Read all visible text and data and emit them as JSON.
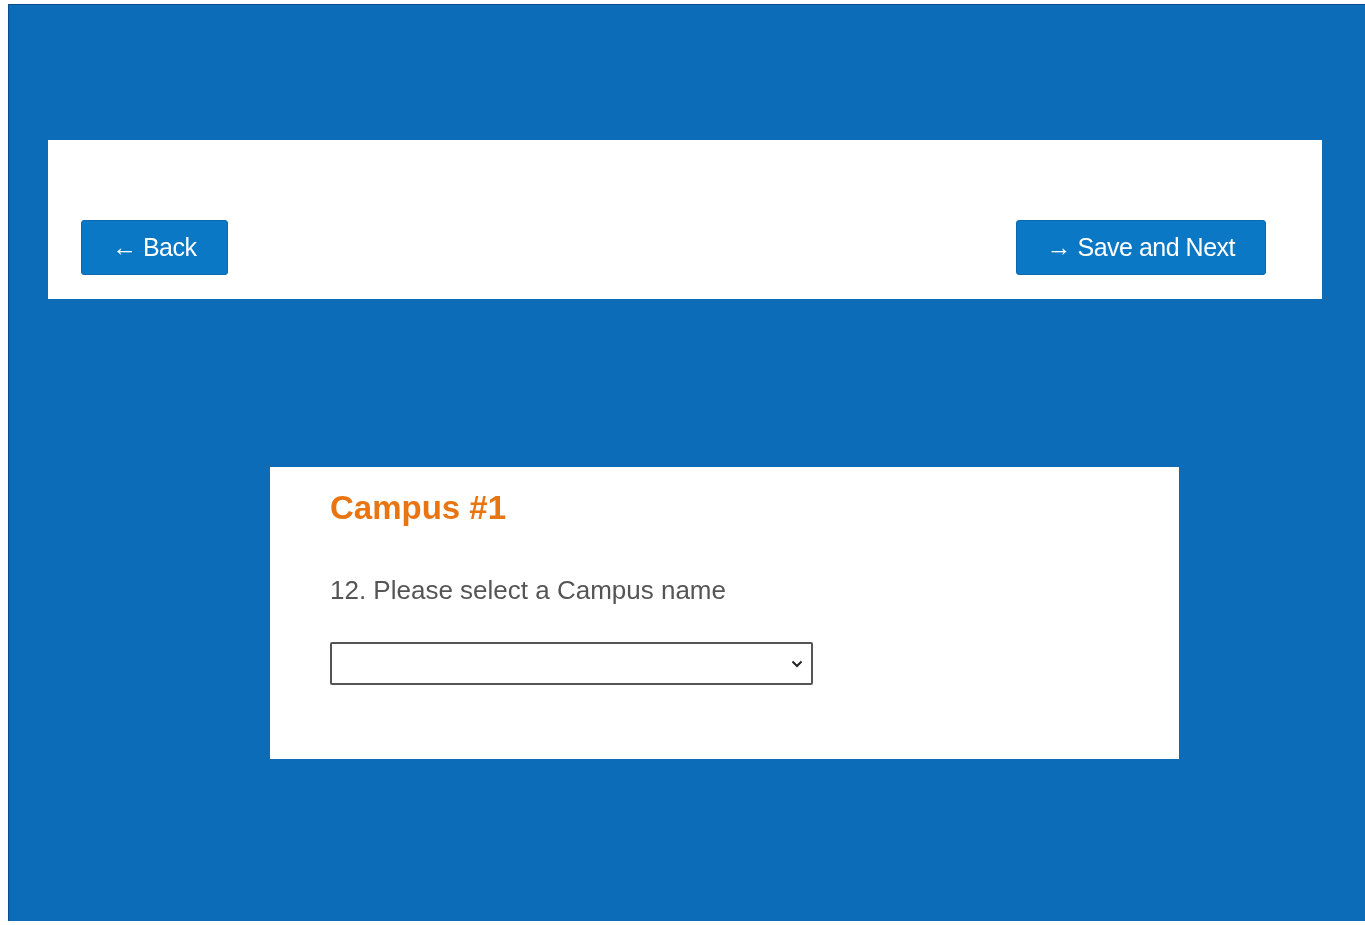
{
  "nav": {
    "buttons": [
      {
        "label": "← Back"
      },
      {
        "label": "→ Save and Next"
      }
    ]
  },
  "card": {
    "title": "Campus #1",
    "question": "12. Please select a Campus name"
  }
}
